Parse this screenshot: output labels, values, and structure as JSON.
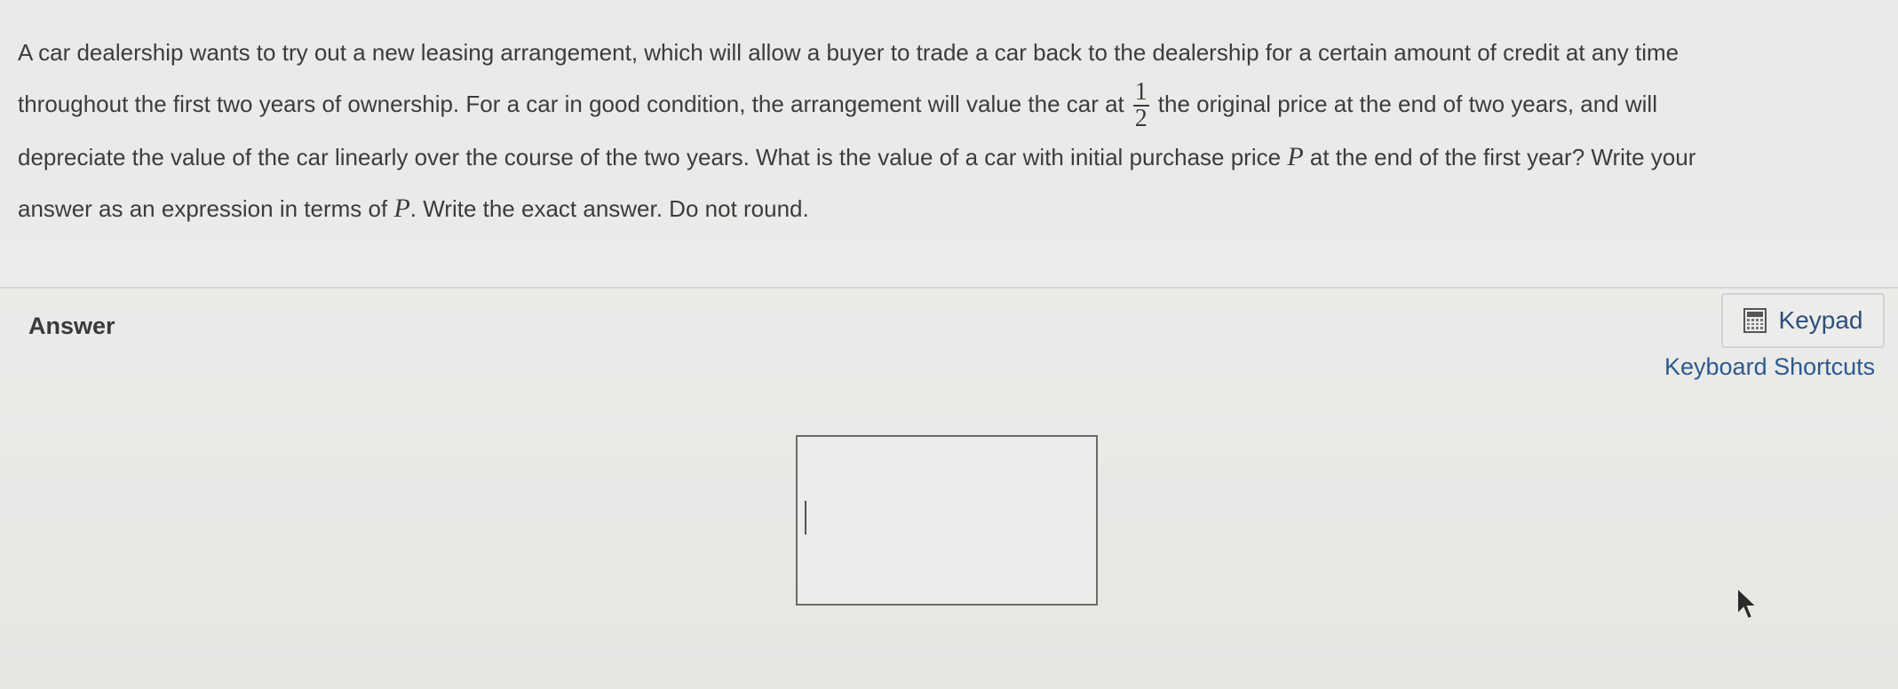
{
  "question": {
    "line1": "A car dealership wants to try out a new leasing arrangement, which will allow a buyer to trade a car back to the dealership for a certain amount of credit at any time",
    "line2_before": "throughout the first two years of ownership. For a car in good condition, the arrangement will value the car at",
    "fraction_numerator": "1",
    "fraction_denominator": "2",
    "line2_after": "the original price at the end of two years, and will",
    "line3_before": "depreciate the value of the car linearly over the course of the two years. What is the value of a car with initial purchase price",
    "line3_var": "P",
    "line3_after": "at the end of the first year? Write your",
    "line4_before": "answer as an expression in terms of",
    "line4_var": "P",
    "line4_after": ". Write the exact answer. Do not round."
  },
  "answer": {
    "label": "Answer",
    "input_value": ""
  },
  "tools": {
    "keypad_label": "Keypad",
    "keypad_icon": "calculator-icon",
    "shortcuts_label": "Keyboard Shortcuts"
  },
  "colors": {
    "background": "#e9e9e7",
    "link": "#2c5a8f",
    "text": "#3c3c3c"
  }
}
